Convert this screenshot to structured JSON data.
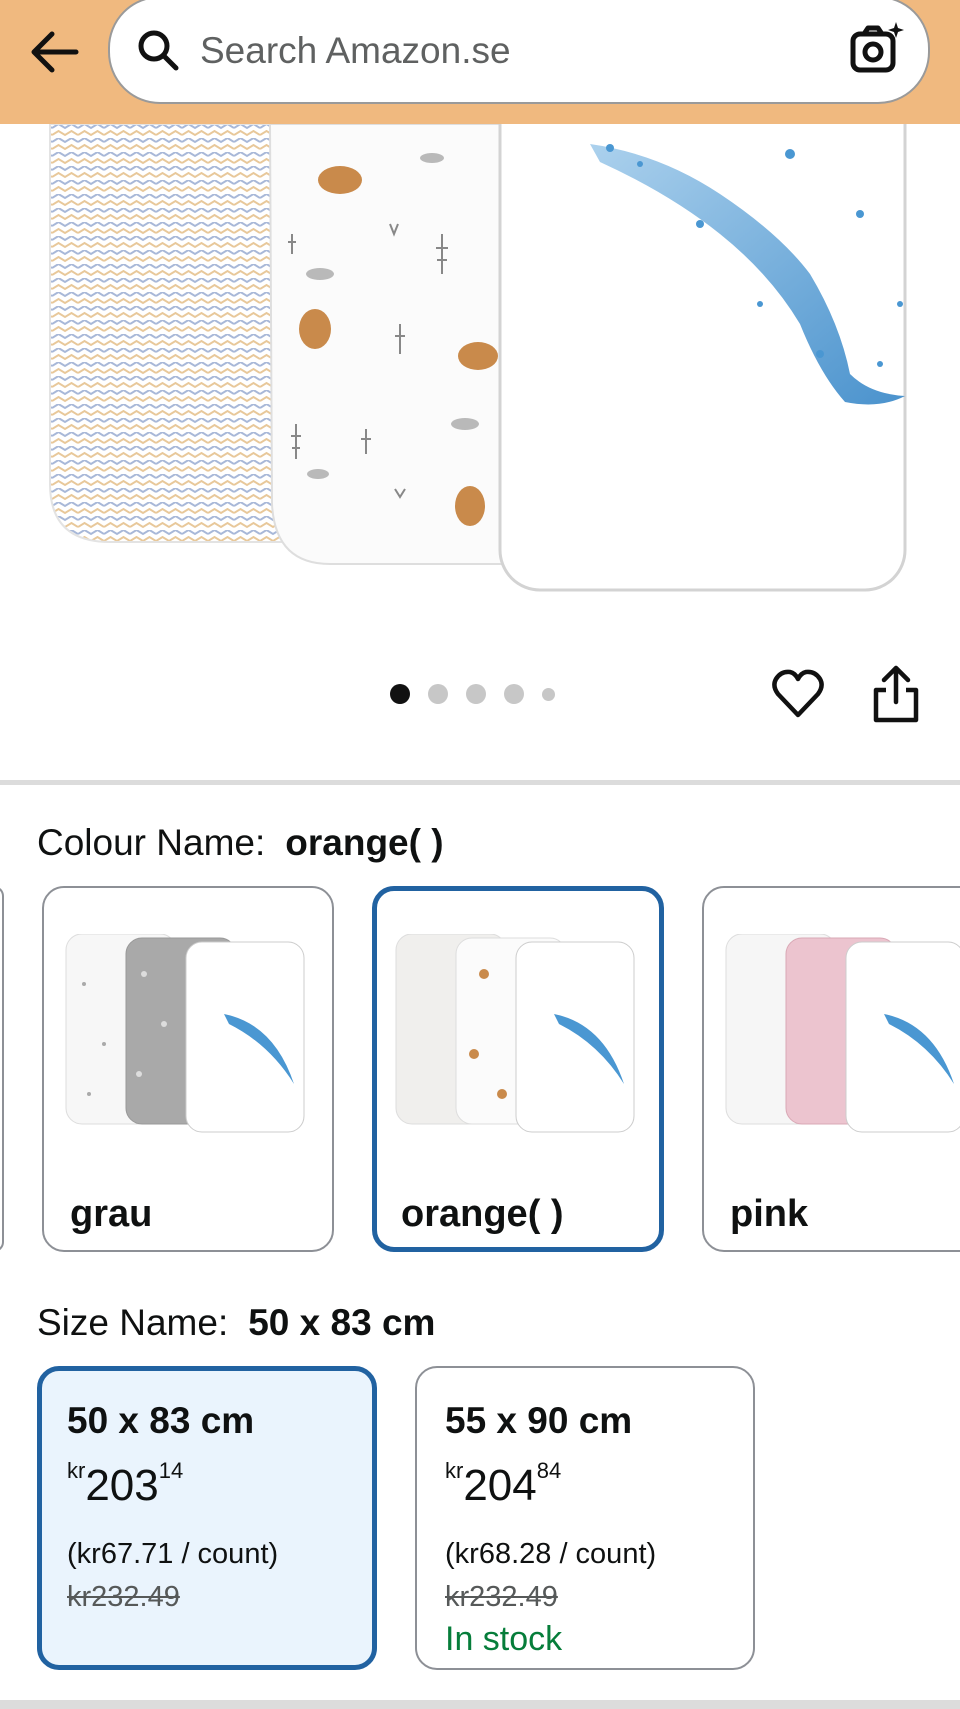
{
  "header": {
    "search_placeholder": "Search Amazon.se",
    "background_color": "#f0b97f",
    "icons": [
      "arrow-left-icon",
      "search-icon",
      "camera-sparkle-icon"
    ]
  },
  "gallery": {
    "image_count": 5,
    "active_index": 0,
    "icons": [
      "heart-icon",
      "share-icon"
    ]
  },
  "colour": {
    "label": "Colour Name:",
    "selected": "orange( )",
    "options": [
      {
        "name": "grau",
        "selected": false
      },
      {
        "name": "orange( )",
        "selected": true
      },
      {
        "name": "pink",
        "selected": false
      }
    ]
  },
  "size": {
    "label": "Size Name:",
    "selected": "50 x 83 cm",
    "options": [
      {
        "name": "50 x 83 cm",
        "currency": "kr",
        "price_whole": "203",
        "price_fraction": "14",
        "unit_price": "(kr67.71 / count)",
        "list_price": "kr232.49",
        "availability": "",
        "selected": true
      },
      {
        "name": "55 x 90 cm",
        "currency": "kr",
        "price_whole": "204",
        "price_fraction": "84",
        "unit_price": "(kr68.28 / count)",
        "list_price": "kr232.49",
        "availability": "In stock",
        "selected": false
      }
    ]
  },
  "colors": {
    "selection_border": "#2162a1",
    "selected_bg": "#eaf4fd",
    "in_stock": "#067d3a"
  }
}
